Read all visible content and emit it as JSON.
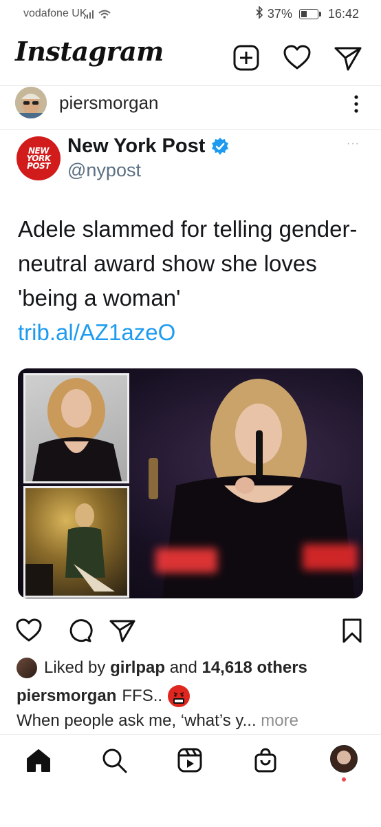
{
  "status_bar": {
    "carrier": "vodafone UK",
    "battery": "37%",
    "time": "16:42",
    "battery_level": 0.37
  },
  "header": {
    "logo": "Instagram",
    "icons": [
      "new-post-icon",
      "heart-icon",
      "direct-message-icon"
    ]
  },
  "post": {
    "username": "piersmorgan",
    "embedded_tweet": {
      "name": "New York Post",
      "handle": "@nypost",
      "logo_text": [
        "NEW",
        "YORK",
        "POST"
      ],
      "text": "Adele slammed for telling gender-neutral award show she loves 'being a woman'",
      "link": "trib.al/AZ1azeO",
      "more": "···"
    },
    "likes": {
      "prefix": "Liked by",
      "user": "girlpap",
      "middle": "and",
      "count": "14,618 others"
    },
    "caption": {
      "username": "piersmorgan",
      "text": "FFS..",
      "line2": "When people ask me, ‘what’s y...",
      "more": "more"
    }
  },
  "colors": {
    "link": "#1d9bf0",
    "verified": "#1d9bf0",
    "nyp_red": "#d21b1b",
    "notification": "#ed4956"
  },
  "bottom_nav": [
    "home-icon",
    "search-icon",
    "reels-icon",
    "shop-icon",
    "profile-avatar"
  ]
}
